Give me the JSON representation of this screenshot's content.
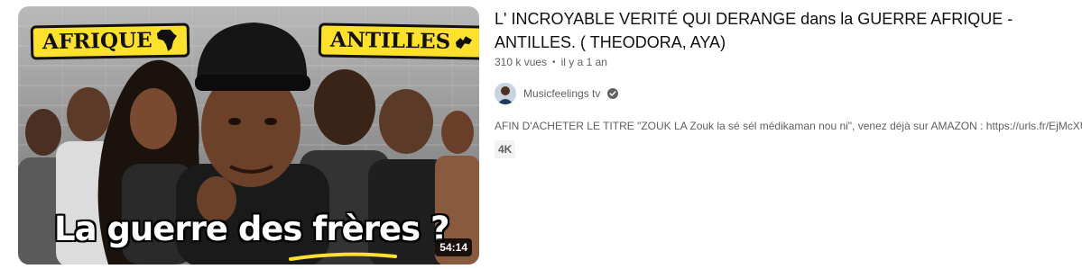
{
  "video": {
    "thumbnail": {
      "tag_left": "AFRIQUE",
      "tag_right": "ANTILLES",
      "headline": "La guerre des frères ?",
      "duration": "54:14",
      "tag_color": "#fde12d"
    },
    "title": "L' INCROYABLE VERITÉ QUI DERANGE dans la GUERRE AFRIQUE - ANTILLES. ( THEODORA, AYA)",
    "views": "310 k vues",
    "age": "il y a 1 an",
    "channel": {
      "name": "Musicfeelings tv",
      "verified_icon": "verified-check-icon"
    },
    "description": "AFIN D'ACHETER LE TITRE \"ZOUK LA Zouk la sé sél médikaman nou ni\", venez déjà sur AMAZON : https://urls.fr/EjMcXU",
    "badge": "4K"
  }
}
